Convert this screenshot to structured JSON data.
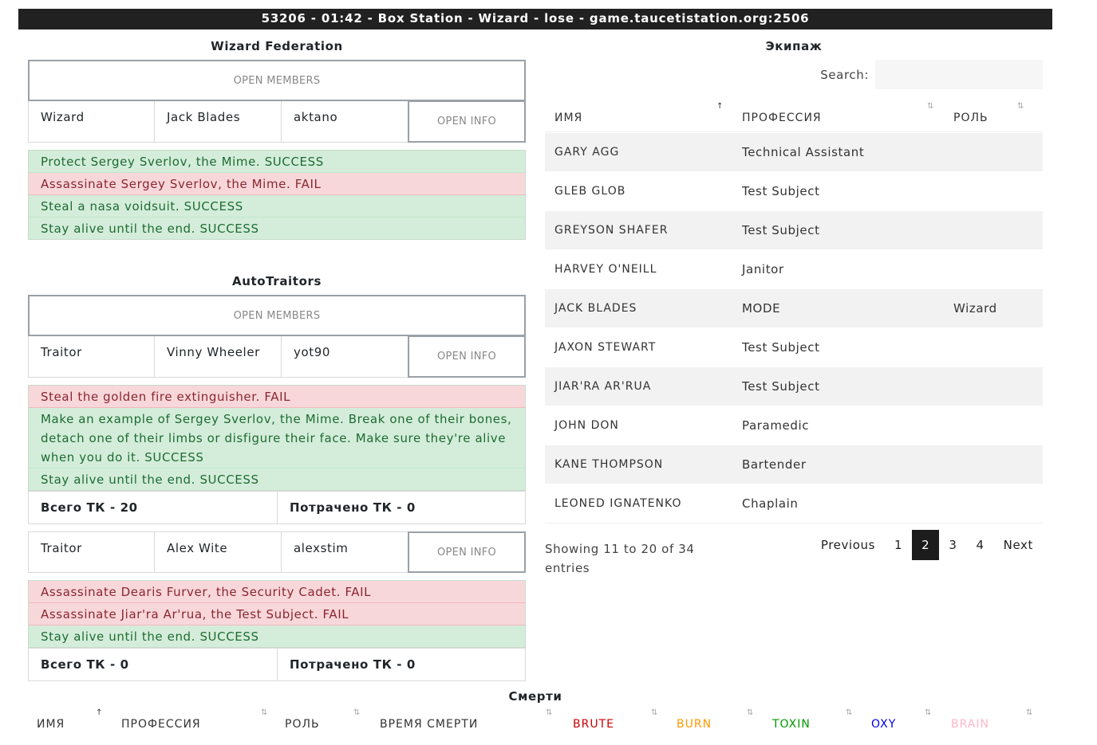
{
  "header": "53206 - 01:42 - Box Station - Wizard - lose - game.taucetistation.org:2506",
  "factions": [
    {
      "title": "Wizard Federation",
      "open_members": "OPEN MEMBERS",
      "members": [
        {
          "role": "Wizard",
          "name": "Jack Blades",
          "ckey": "aktano",
          "info_button": "OPEN INFO",
          "objectives": [
            {
              "text": "Protect Sergey Sverlov, the Mime.",
              "result": "SUCCESS",
              "status": "success"
            },
            {
              "text": "Assassinate Sergey Sverlov, the Mime.",
              "result": "FAIL",
              "status": "fail"
            },
            {
              "text": "Steal a nasa voidsuit.",
              "result": "SUCCESS",
              "status": "success"
            },
            {
              "text": "Stay alive until the end.",
              "result": "SUCCESS",
              "status": "success"
            }
          ]
        }
      ]
    },
    {
      "title": "AutoTraitors",
      "open_members": "OPEN MEMBERS",
      "members": [
        {
          "role": "Traitor",
          "name": "Vinny Wheeler",
          "ckey": "yot90",
          "info_button": "OPEN INFO",
          "objectives": [
            {
              "text": "Steal the golden fire extinguisher.",
              "result": "FAIL",
              "status": "fail"
            },
            {
              "text": "Make an example of Sergey Sverlov, the Mime. Break one of their bones, detach one of their limbs or disfigure their face. Make sure they're alive when you do it.",
              "result": "SUCCESS",
              "status": "success"
            },
            {
              "text": "Stay alive until the end.",
              "result": "SUCCESS",
              "status": "success"
            }
          ],
          "tc_total": "Всего ТК - 20",
          "tc_spent": "Потрачено ТК - 0"
        },
        {
          "role": "Traitor",
          "name": "Alex Wite",
          "ckey": "alexstim",
          "info_button": "OPEN INFO",
          "objectives": [
            {
              "text": "Assassinate Dearis Furver, the Security Cadet.",
              "result": "FAIL",
              "status": "fail"
            },
            {
              "text": "Assassinate Jiar'ra Ar'rua, the Test Subject.",
              "result": "FAIL",
              "status": "fail"
            },
            {
              "text": "Stay alive until the end.",
              "result": "SUCCESS",
              "status": "success"
            }
          ],
          "tc_total": "Всего ТК - 0",
          "tc_spent": "Потрачено ТК - 0"
        }
      ]
    }
  ],
  "crew": {
    "title": "Экипаж",
    "search_label": "Search:",
    "search_value": "",
    "columns": [
      "ИМЯ",
      "ПРОФЕССИЯ",
      "РОЛЬ"
    ],
    "sort_icons": [
      "↑",
      "⇅",
      "⇅"
    ],
    "rows": [
      {
        "name": "Gary Agg",
        "profession": "Technical Assistant",
        "role": ""
      },
      {
        "name": "Gleb Glob",
        "profession": "Test Subject",
        "role": ""
      },
      {
        "name": "Greyson Shafer",
        "profession": "Test Subject",
        "role": ""
      },
      {
        "name": "Harvey O'Neill",
        "profession": "Janitor",
        "role": ""
      },
      {
        "name": "Jack Blades",
        "profession": "MODE",
        "role": "Wizard"
      },
      {
        "name": "Jaxon Stewart",
        "profession": "Test Subject",
        "role": ""
      },
      {
        "name": "Jiar'ra Ar'rua",
        "profession": "Test Subject",
        "role": ""
      },
      {
        "name": "John Don",
        "profession": "Paramedic",
        "role": ""
      },
      {
        "name": "Kane Thompson",
        "profession": "Bartender",
        "role": ""
      },
      {
        "name": "Leoned Ignatenko",
        "profession": "Chaplain",
        "role": ""
      }
    ],
    "showing": "Showing 11 to 20 of 34 entries",
    "pagination": {
      "previous": "Previous",
      "pages": [
        "1",
        "2",
        "3",
        "4"
      ],
      "current": "2",
      "next": "Next"
    }
  },
  "deaths": {
    "title": "Смерти",
    "columns": [
      {
        "label": "ИМЯ",
        "color": "#333333",
        "sort": "↑"
      },
      {
        "label": "ПРОФЕССИЯ",
        "color": "#333333",
        "sort": "⇅"
      },
      {
        "label": "РОЛЬ",
        "color": "#333333",
        "sort": "⇅"
      },
      {
        "label": "ВРЕМЯ СМЕРТИ",
        "color": "#333333",
        "sort": "⇅"
      },
      {
        "label": "BRUTE",
        "color": "#cc0000",
        "sort": "⇅"
      },
      {
        "label": "BURN",
        "color": "#ff9900",
        "sort": "⇅"
      },
      {
        "label": "TOXIN",
        "color": "#009900",
        "sort": "⇅"
      },
      {
        "label": "OXY",
        "color": "#0000ee",
        "sort": "⇅"
      },
      {
        "label": "BRAIN",
        "color": "#ffb6c8",
        "sort": "⇅"
      }
    ]
  }
}
